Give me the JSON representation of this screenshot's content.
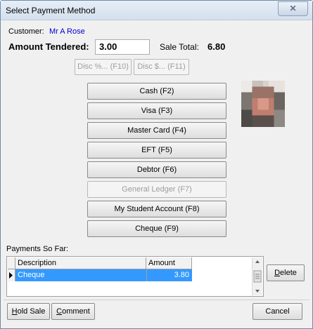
{
  "window": {
    "title": "Select Payment Method",
    "close_glyph": "✕"
  },
  "customer": {
    "label": "Customer:",
    "name": "Mr A Rose"
  },
  "amount": {
    "label": "Amount Tendered:",
    "value": "3.00"
  },
  "sale_total": {
    "label": "Sale Total:",
    "value": "6.80"
  },
  "discount_buttons": [
    "Disc %... (F10)",
    "Disc $... (F11)"
  ],
  "payment_methods": [
    {
      "label": "Cash (F2)",
      "enabled": true
    },
    {
      "label": "Visa (F3)",
      "enabled": true
    },
    {
      "label": "Master Card (F4)",
      "enabled": true
    },
    {
      "label": "EFT (F5)",
      "enabled": true
    },
    {
      "label": "Debtor (F6)",
      "enabled": true
    },
    {
      "label": "General Ledger (F7)",
      "enabled": false
    },
    {
      "label": "My Student Account (F8)",
      "enabled": true
    },
    {
      "label": "Cheque (F9)",
      "enabled": true
    }
  ],
  "payments": {
    "label": "Payments So Far:",
    "columns": [
      "Description",
      "Amount"
    ],
    "rows": [
      {
        "description": "Cheque",
        "amount": "3.80"
      }
    ]
  },
  "buttons": {
    "delete_first": "D",
    "delete_rest": "elete",
    "hold_first": "H",
    "hold_rest": "old Sale",
    "comment_first": "C",
    "comment_rest": "omment",
    "cancel": "Cancel"
  },
  "colors": {
    "customer_name": "#0000cc",
    "selection": "#3399ff"
  }
}
